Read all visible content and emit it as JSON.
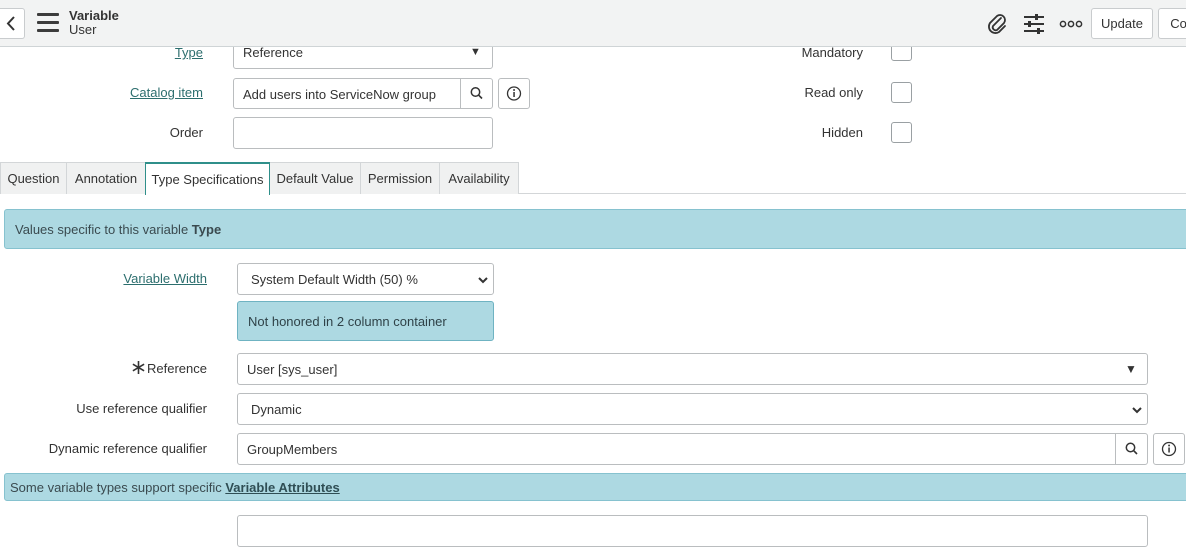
{
  "header": {
    "title": "Variable",
    "subtitle": "User",
    "update_label": "Update",
    "copy_label": "Co"
  },
  "form": {
    "type_label": "Type",
    "type_value": "Reference",
    "catalog_item_label": "Catalog item",
    "catalog_item_value": "Add users into ServiceNow group",
    "order_label": "Order",
    "order_value": "",
    "mandatory_label": "Mandatory",
    "read_only_label": "Read only",
    "hidden_label": "Hidden"
  },
  "tabs": [
    {
      "label": "Question"
    },
    {
      "label": "Annotation"
    },
    {
      "label": "Type Specifications"
    },
    {
      "label": "Default Value"
    },
    {
      "label": "Permission"
    },
    {
      "label": "Availability"
    }
  ],
  "type_specs": {
    "banner_prefix": "Values specific to this variable ",
    "banner_bold": "Type",
    "variable_width_label": "Variable Width",
    "variable_width_value": "System Default Width (50) %",
    "note": "Not honored in 2 column container",
    "reference_label": "Reference",
    "reference_value": "User [sys_user]",
    "use_ref_qualifier_label": "Use reference qualifier",
    "use_ref_qualifier_value": "Dynamic",
    "dynamic_ref_qualifier_label": "Dynamic reference qualifier",
    "dynamic_ref_qualifier_value": "GroupMembers",
    "attributes_prefix": "Some variable types support specific ",
    "attributes_link": "Variable Attributes"
  },
  "colors": {
    "accent": "#2f8f8a",
    "banner": "#add9e2",
    "link": "#2c6e6e"
  }
}
